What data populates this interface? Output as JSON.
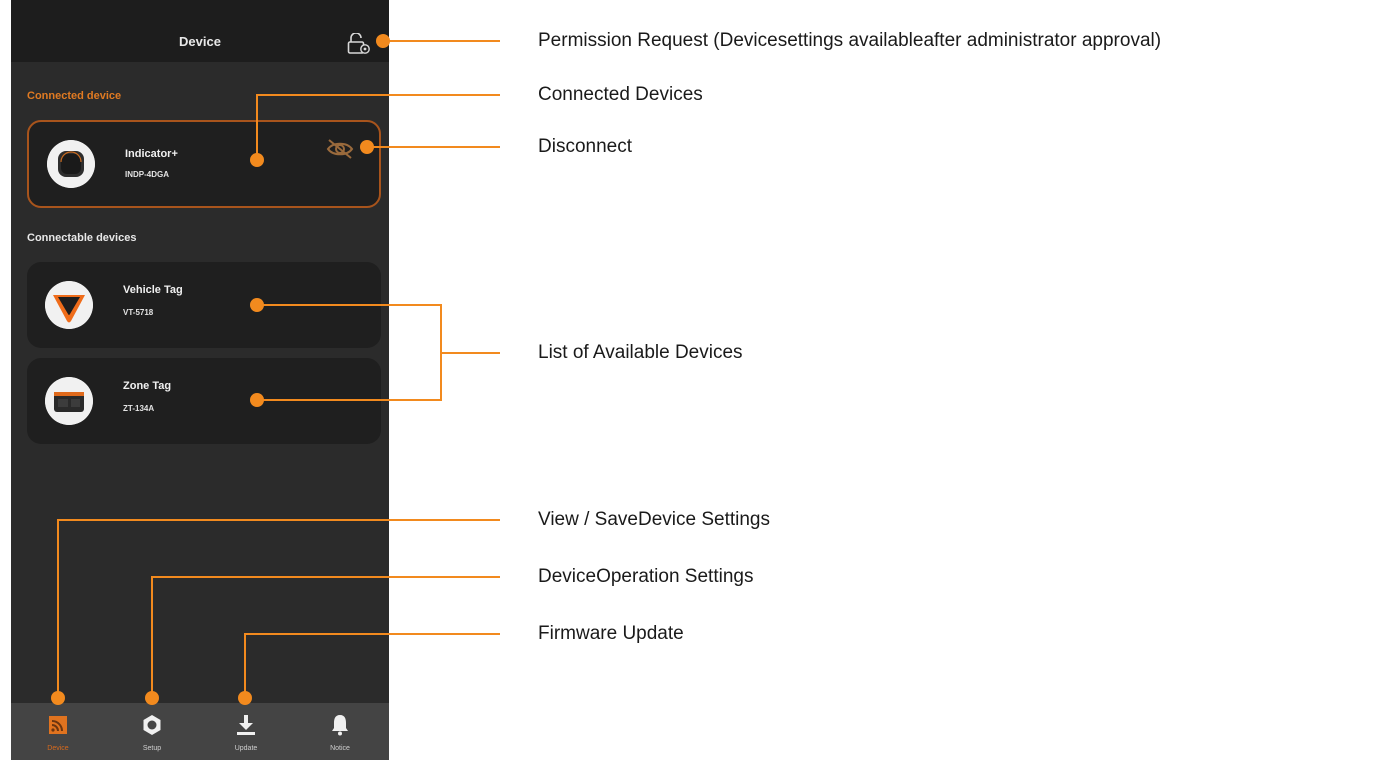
{
  "app": {
    "header_title": "Device",
    "lock_icon": "lock-icon",
    "accent_color": "#f28a1e",
    "sections": {
      "connected_label": "Connected device",
      "connectable_label": "Connectable devices"
    },
    "connected_device": {
      "name": "Indicator+",
      "code": "INDP-4DGA",
      "icon": "disconnect-icon"
    },
    "connectable_devices": [
      {
        "name": "Vehicle Tag",
        "code": "VT-5718"
      },
      {
        "name": "Zone Tag",
        "code": "ZT-134A"
      }
    ],
    "nav": [
      {
        "label": "Device",
        "icon": "device-icon",
        "active": true
      },
      {
        "label": "Setup",
        "icon": "hexagon-settings-icon",
        "active": false
      },
      {
        "label": "Update",
        "icon": "download-icon",
        "active": false
      },
      {
        "label": "Notice",
        "icon": "bell-icon",
        "active": false
      }
    ]
  },
  "annotations": {
    "permission": "Permission Request  (Devicesettings availableafter administrator approval)",
    "connected": "Connected Devices",
    "disconnect": "Disconnect",
    "available": "List of Available Devices",
    "view_save": "View /  SaveDevice Settings",
    "operation": "DeviceOperation Settings",
    "firmware": "Firmware Update"
  }
}
